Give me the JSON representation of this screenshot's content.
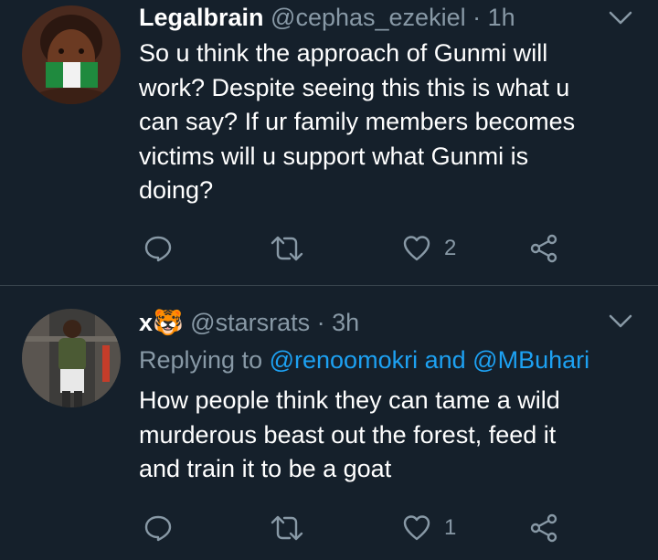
{
  "tweets": [
    {
      "display_name": "Legalbrain",
      "handle": "@cephas_ezekiel",
      "separator": "·",
      "time": "1h",
      "text": "So u think the approach of Gunmi will\nwork? Despite seeing this this is what u\ncan say? If ur family members becomes\nvictims will u support what Gunmi is\ndoing?",
      "actions": {
        "reply_count": "",
        "retweet_count": "",
        "like_count": "2"
      }
    },
    {
      "display_name": "x",
      "name_emoji": "🐯",
      "handle": "@starsrats",
      "separator": "·",
      "time": "3h",
      "replying_to": {
        "prefix": "Replying to",
        "mention_1": "@renoomokri",
        "joiner": "and",
        "mention_2": "@MBuhari"
      },
      "text": "How people think they can tame a wild\nmurderous beast out the forest, feed it\nand train it to be a goat",
      "actions": {
        "reply_count": "",
        "retweet_count": "",
        "like_count": "1"
      }
    }
  ],
  "colors": {
    "background": "#15202b",
    "divider": "#38444d",
    "primary_text": "#ffffff",
    "secondary_text": "#8899a6",
    "link": "#1da1f2"
  },
  "icons": {
    "reply": "speech-bubble-icon",
    "retweet": "retweet-arrows-icon",
    "like": "heart-outline-icon",
    "share": "share-nodes-icon",
    "more": "chevron-down-icon"
  }
}
